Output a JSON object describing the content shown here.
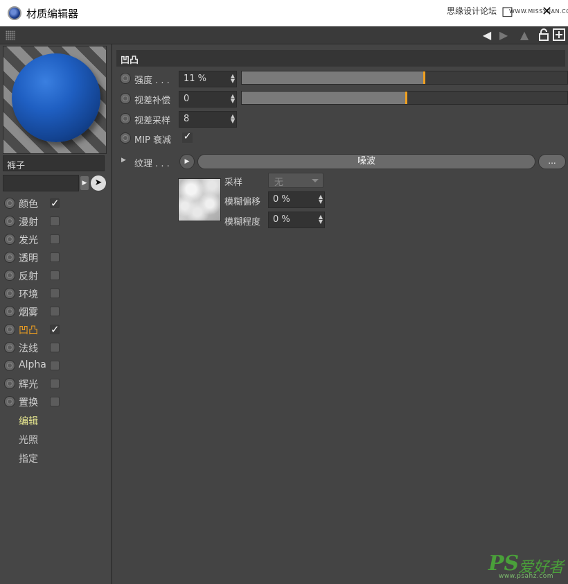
{
  "window": {
    "title": "材质编辑器",
    "watermark": "思缘设计论坛",
    "watermark_url": "WWW.MISSYUAN.COM",
    "minimize": "□",
    "close": "✕"
  },
  "toolbar": {
    "icons": [
      "arrow-left-icon",
      "arrow-up-icon",
      "lock-icon",
      "new-window-icon"
    ]
  },
  "material": {
    "name": "裤子",
    "preview_color": "#1f5fc2"
  },
  "channels": [
    {
      "label": "颜色",
      "checked": true,
      "active": false
    },
    {
      "label": "漫射",
      "checked": false,
      "active": false
    },
    {
      "label": "发光",
      "checked": false,
      "active": false
    },
    {
      "label": "透明",
      "checked": false,
      "active": false
    },
    {
      "label": "反射",
      "checked": false,
      "active": false
    },
    {
      "label": "环境",
      "checked": false,
      "active": false
    },
    {
      "label": "烟雾",
      "checked": false,
      "active": false
    },
    {
      "label": "凹凸",
      "checked": true,
      "active": true
    },
    {
      "label": "法线",
      "checked": false,
      "active": false
    },
    {
      "label": "Alpha",
      "checked": false,
      "active": false
    },
    {
      "label": "辉光",
      "checked": false,
      "active": false
    },
    {
      "label": "置换",
      "checked": false,
      "active": false
    }
  ],
  "nav": [
    "编辑",
    "光照",
    "指定"
  ],
  "section": {
    "title": "凹凸",
    "params": [
      {
        "label": "强度 . . .",
        "value": "11 %",
        "slider": 0.56
      },
      {
        "label": "视差补偿",
        "value": "0",
        "slider": 0.505
      },
      {
        "label": "视差采样",
        "value": "8"
      }
    ],
    "mip": {
      "label": "MIP 衰减",
      "checked": true
    },
    "texture": {
      "label": "纹理 . . .",
      "shader": "噪波",
      "more": "...",
      "sampling_label": "采样",
      "sampling_value": "无",
      "blur_offset_label": "模糊偏移",
      "blur_offset_value": "0 %",
      "blur_scale_label": "模糊程度",
      "blur_scale_value": "0 %"
    }
  },
  "colors": {
    "accent": "#f0a020",
    "panel": "#444444"
  },
  "site_watermark": {
    "logo": "PS",
    "logo_text": "爱好者",
    "url": "www.psahz.com"
  }
}
